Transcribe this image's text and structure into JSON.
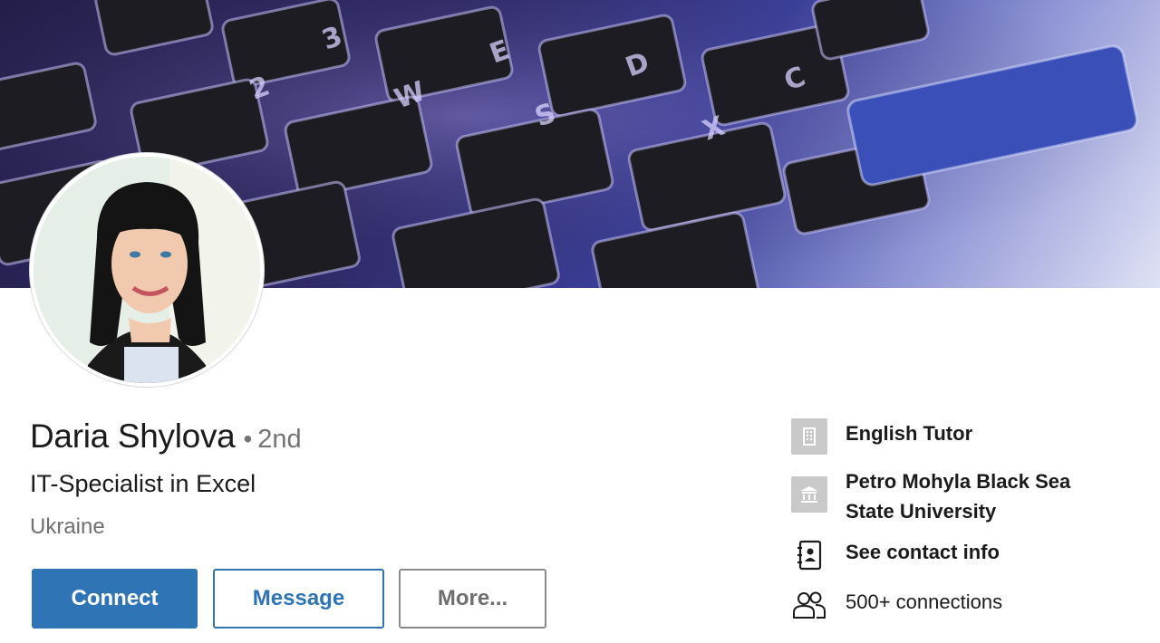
{
  "profile": {
    "name": "Daria Shylova",
    "degree_separator": "•",
    "degree": "2nd",
    "headline": "IT-Specialist in Excel",
    "location": "Ukraine"
  },
  "actions": {
    "connect_label": "Connect",
    "message_label": "Message",
    "more_label": "More..."
  },
  "info": {
    "company": {
      "label": "English Tutor",
      "icon": "building-icon"
    },
    "education": {
      "label_line1": "Petro Mohyla Black Sea",
      "label_line2": "State University",
      "icon": "school-icon"
    },
    "contact": {
      "label": "See contact info",
      "icon": "contact-card-icon"
    },
    "connections": {
      "label": "500+ connections",
      "icon": "people-icon"
    }
  },
  "colors": {
    "primary": "#2f74b5",
    "muted_text": "#707070",
    "icon_box": "#c9c9c9"
  }
}
